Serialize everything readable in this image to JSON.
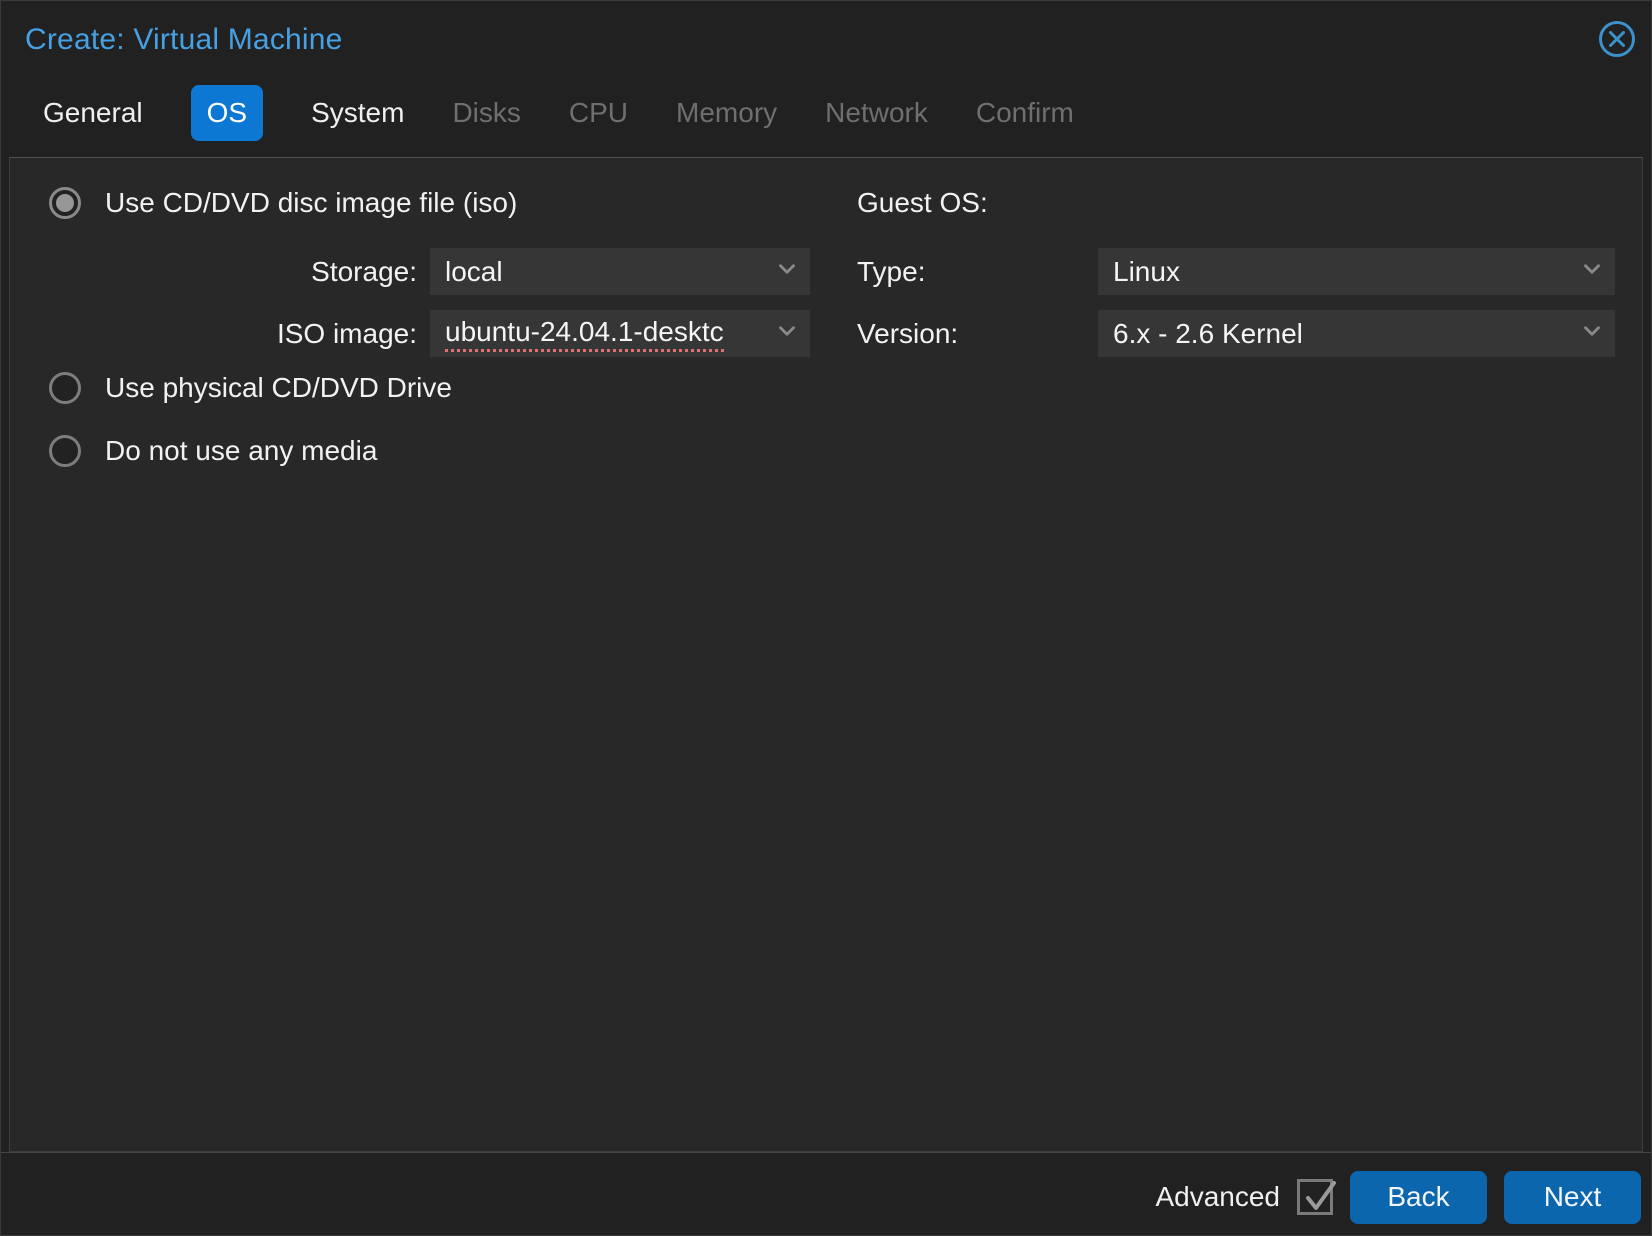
{
  "window": {
    "title": "Create: Virtual Machine",
    "close_icon": "circled-x"
  },
  "tabs": [
    {
      "label": "General",
      "state": "enabled"
    },
    {
      "label": "OS",
      "state": "active"
    },
    {
      "label": "System",
      "state": "enabled"
    },
    {
      "label": "Disks",
      "state": "disabled"
    },
    {
      "label": "CPU",
      "state": "disabled"
    },
    {
      "label": "Memory",
      "state": "disabled"
    },
    {
      "label": "Network",
      "state": "disabled"
    },
    {
      "label": "Confirm",
      "state": "disabled"
    }
  ],
  "media_options": {
    "iso_option": {
      "label": "Use CD/DVD disc image file (iso)",
      "selected": true,
      "storage": {
        "label": "Storage:",
        "value": "local"
      },
      "iso_image": {
        "label": "ISO image:",
        "value": "ubuntu-24.04.1-desktc",
        "spellcheck_underline": true
      }
    },
    "physical_option": {
      "label": "Use physical CD/DVD Drive",
      "selected": false
    },
    "no_media_option": {
      "label": "Do not use any media",
      "selected": false
    }
  },
  "guest_os": {
    "heading": "Guest OS:",
    "type": {
      "label": "Type:",
      "value": "Linux"
    },
    "version": {
      "label": "Version:",
      "value": "6.x - 2.6 Kernel"
    }
  },
  "footer": {
    "advanced_label": "Advanced",
    "advanced_checked": true,
    "back_label": "Back",
    "next_label": "Next"
  },
  "colors": {
    "title_blue": "#46a0e2",
    "active_tab_blue": "#0d78d3",
    "button_blue": "#0b66ae",
    "invalid_underline_red": "#e07070",
    "panel_bg": "#282828",
    "field_bg": "#363636"
  }
}
